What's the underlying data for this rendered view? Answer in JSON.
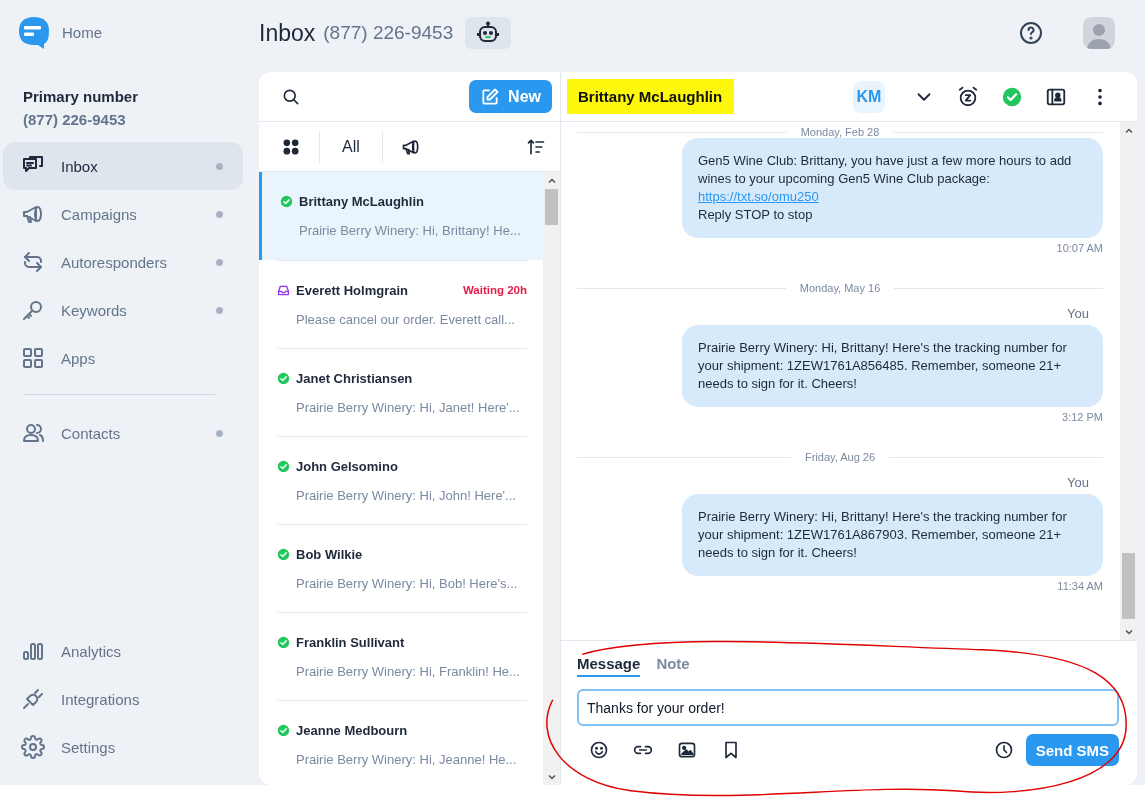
{
  "sidebar": {
    "home_label": "Home",
    "primary_label": "Primary number",
    "primary_number": "(877) 226-9453",
    "items": [
      {
        "label": "Inbox",
        "selected": true,
        "dot": true
      },
      {
        "label": "Campaigns",
        "selected": false,
        "dot": true
      },
      {
        "label": "Autoresponders",
        "selected": false,
        "dot": true
      },
      {
        "label": "Keywords",
        "selected": false,
        "dot": true
      },
      {
        "label": "Apps",
        "selected": false,
        "dot": false
      }
    ],
    "secondary_items": [
      {
        "label": "Contacts",
        "selected": false,
        "dot": true
      }
    ],
    "bottom_items": [
      {
        "label": "Analytics",
        "selected": false,
        "dot": false
      },
      {
        "label": "Integrations",
        "selected": false,
        "dot": false
      },
      {
        "label": "Settings",
        "selected": false,
        "dot": false
      }
    ]
  },
  "header": {
    "title": "Inbox",
    "number": "(877) 226-9453"
  },
  "list": {
    "new_label": "New",
    "filter_label": "All",
    "conversations": [
      {
        "name": "Brittany McLaughlin",
        "preview": "Prairie Berry Winery: Hi, Brittany! He...",
        "kind": "resolved",
        "selected": true
      },
      {
        "name": "Everett Holmgrain",
        "preview": "Please cancel our order. Everett call...",
        "kind": "open",
        "waiting": "Waiting 20h",
        "selected": false
      },
      {
        "name": "Janet Christiansen",
        "preview": "Prairie Berry Winery: Hi, Janet! Here'...",
        "kind": "resolved",
        "selected": false
      },
      {
        "name": "John Gelsomino",
        "preview": "Prairie Berry Winery: Hi, John! Here'...",
        "kind": "resolved",
        "selected": false
      },
      {
        "name": "Bob Wilkie",
        "preview": "Prairie Berry Winery: Hi, Bob! Here's...",
        "kind": "resolved",
        "selected": false
      },
      {
        "name": "Franklin Sullivant",
        "preview": "Prairie Berry Winery: Hi, Franklin! He...",
        "kind": "resolved",
        "selected": false
      },
      {
        "name": "Jeanne Medbourn",
        "preview": "Prairie Berry Winery: Hi, Jeanne! He...",
        "kind": "resolved",
        "selected": false
      }
    ]
  },
  "chat": {
    "contact_name": "Brittany McLaughlin",
    "highlighted": true,
    "assignee_initials": "KM",
    "feed": [
      {
        "kind": "date",
        "text": "Monday, Feb 28"
      },
      {
        "kind": "message",
        "text": "Gen5 Wine Club: Brittany, you have just a few more hours to add wines to your upcoming Gen5 Wine Club package:",
        "link": "https://txt.so/omu250",
        "after": "Reply STOP to stop",
        "time": "10:07 AM"
      },
      {
        "kind": "date",
        "text": "Monday, May 16"
      },
      {
        "kind": "message",
        "sender": "You",
        "text": "Prairie Berry Winery: Hi, Brittany! Here's the tracking number for your shipment: 1ZEW1761A856485. Remember, someone 21+ needs to sign for it. Cheers!",
        "time": "3:12 PM"
      },
      {
        "kind": "date",
        "text": "Friday, Aug 26"
      },
      {
        "kind": "message",
        "sender": "You",
        "text": "Prairie Berry Winery: Hi, Brittany! Here's the tracking number for your shipment: 1ZEW1761A867903. Remember, someone 21+ needs to sign for it. Cheers!",
        "time": "11:34 AM"
      }
    ],
    "composer": {
      "tabs": [
        {
          "label": "Message",
          "selected": true
        },
        {
          "label": "Note",
          "selected": false
        }
      ],
      "value": "Thanks for your order!",
      "send_label": "Send SMS"
    }
  }
}
